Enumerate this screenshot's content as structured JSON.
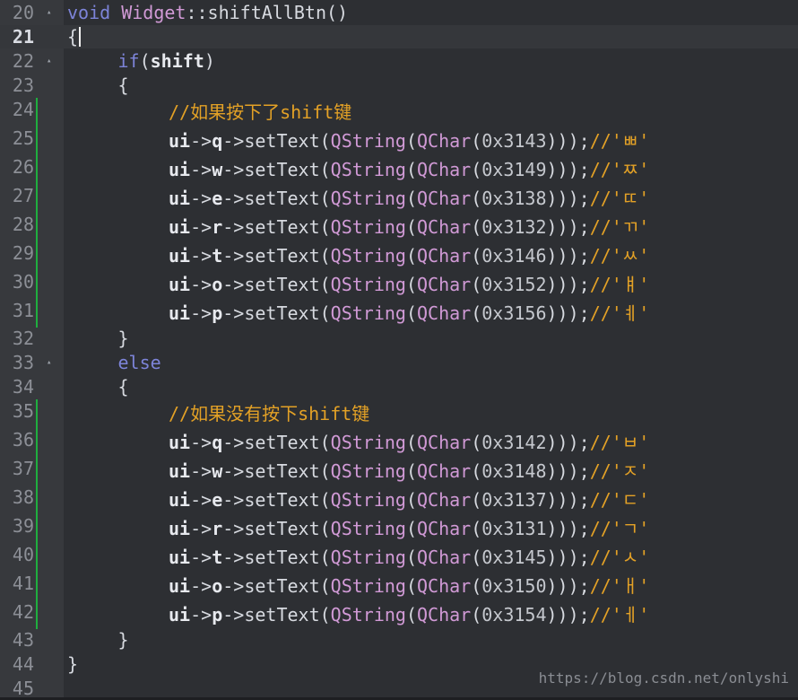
{
  "colors": {
    "background": "#2d2f33",
    "gutter": "#37393d",
    "keyword": "#7d84d9",
    "class": "#d19ad6",
    "identifier": "#e7e9ee",
    "comment": "#e3a126",
    "change_marker": "#1fae3f"
  },
  "watermark": "https://blog.csdn.net/onlyshi",
  "lines": [
    {
      "n": "20",
      "fold": true,
      "indent": 0,
      "tokens": [
        {
          "t": "kw",
          "v": "void"
        },
        {
          "t": "p",
          "v": " "
        },
        {
          "t": "cls",
          "v": "Widget"
        },
        {
          "t": "p",
          "v": "::shiftAllBtn()"
        }
      ]
    },
    {
      "n": "21",
      "current": true,
      "indent": 0,
      "cursor": true,
      "tokens": [
        {
          "t": "p",
          "v": "{"
        }
      ]
    },
    {
      "n": "22",
      "fold": true,
      "indent": 1,
      "tokens": [
        {
          "t": "kw",
          "v": "if"
        },
        {
          "t": "p",
          "v": "("
        },
        {
          "t": "id",
          "v": "shift"
        },
        {
          "t": "p",
          "v": ")"
        }
      ]
    },
    {
      "n": "23",
      "indent": 1,
      "tokens": [
        {
          "t": "p",
          "v": "{"
        }
      ]
    },
    {
      "n": "24",
      "mark": true,
      "indent": 2,
      "tokens": [
        {
          "t": "com",
          "v": "//如果按下了shift键"
        }
      ]
    },
    {
      "n": "25",
      "mark": true,
      "indent": 2,
      "tokens": [
        {
          "t": "id",
          "v": "ui"
        },
        {
          "t": "p",
          "v": "->"
        },
        {
          "t": "id",
          "v": "q"
        },
        {
          "t": "p",
          "v": "->setText("
        },
        {
          "t": "cls",
          "v": "QString"
        },
        {
          "t": "p",
          "v": "("
        },
        {
          "t": "cls",
          "v": "QChar"
        },
        {
          "t": "p",
          "v": "("
        },
        {
          "t": "num",
          "v": "0x3143"
        },
        {
          "t": "p",
          "v": ")));"
        },
        {
          "t": "com",
          "v": "//'ㅃ'"
        }
      ]
    },
    {
      "n": "26",
      "mark": true,
      "indent": 2,
      "tokens": [
        {
          "t": "id",
          "v": "ui"
        },
        {
          "t": "p",
          "v": "->"
        },
        {
          "t": "id",
          "v": "w"
        },
        {
          "t": "p",
          "v": "->setText("
        },
        {
          "t": "cls",
          "v": "QString"
        },
        {
          "t": "p",
          "v": "("
        },
        {
          "t": "cls",
          "v": "QChar"
        },
        {
          "t": "p",
          "v": "("
        },
        {
          "t": "num",
          "v": "0x3149"
        },
        {
          "t": "p",
          "v": ")));"
        },
        {
          "t": "com",
          "v": "//'ㅉ'"
        }
      ]
    },
    {
      "n": "27",
      "mark": true,
      "indent": 2,
      "tokens": [
        {
          "t": "id",
          "v": "ui"
        },
        {
          "t": "p",
          "v": "->"
        },
        {
          "t": "id",
          "v": "e"
        },
        {
          "t": "p",
          "v": "->setText("
        },
        {
          "t": "cls",
          "v": "QString"
        },
        {
          "t": "p",
          "v": "("
        },
        {
          "t": "cls",
          "v": "QChar"
        },
        {
          "t": "p",
          "v": "("
        },
        {
          "t": "num",
          "v": "0x3138"
        },
        {
          "t": "p",
          "v": ")));"
        },
        {
          "t": "com",
          "v": "//'ㄸ'"
        }
      ]
    },
    {
      "n": "28",
      "mark": true,
      "indent": 2,
      "tokens": [
        {
          "t": "id",
          "v": "ui"
        },
        {
          "t": "p",
          "v": "->"
        },
        {
          "t": "id",
          "v": "r"
        },
        {
          "t": "p",
          "v": "->setText("
        },
        {
          "t": "cls",
          "v": "QString"
        },
        {
          "t": "p",
          "v": "("
        },
        {
          "t": "cls",
          "v": "QChar"
        },
        {
          "t": "p",
          "v": "("
        },
        {
          "t": "num",
          "v": "0x3132"
        },
        {
          "t": "p",
          "v": ")));"
        },
        {
          "t": "com",
          "v": "//'ㄲ'"
        }
      ]
    },
    {
      "n": "29",
      "mark": true,
      "indent": 2,
      "tokens": [
        {
          "t": "id",
          "v": "ui"
        },
        {
          "t": "p",
          "v": "->"
        },
        {
          "t": "id",
          "v": "t"
        },
        {
          "t": "p",
          "v": "->setText("
        },
        {
          "t": "cls",
          "v": "QString"
        },
        {
          "t": "p",
          "v": "("
        },
        {
          "t": "cls",
          "v": "QChar"
        },
        {
          "t": "p",
          "v": "("
        },
        {
          "t": "num",
          "v": "0x3146"
        },
        {
          "t": "p",
          "v": ")));"
        },
        {
          "t": "com",
          "v": "//'ㅆ'"
        }
      ]
    },
    {
      "n": "30",
      "mark": true,
      "indent": 2,
      "tokens": [
        {
          "t": "id",
          "v": "ui"
        },
        {
          "t": "p",
          "v": "->"
        },
        {
          "t": "id",
          "v": "o"
        },
        {
          "t": "p",
          "v": "->setText("
        },
        {
          "t": "cls",
          "v": "QString"
        },
        {
          "t": "p",
          "v": "("
        },
        {
          "t": "cls",
          "v": "QChar"
        },
        {
          "t": "p",
          "v": "("
        },
        {
          "t": "num",
          "v": "0x3152"
        },
        {
          "t": "p",
          "v": ")));"
        },
        {
          "t": "com",
          "v": "//'ㅒ'"
        }
      ]
    },
    {
      "n": "31",
      "mark": true,
      "indent": 2,
      "tokens": [
        {
          "t": "id",
          "v": "ui"
        },
        {
          "t": "p",
          "v": "->"
        },
        {
          "t": "id",
          "v": "p"
        },
        {
          "t": "p",
          "v": "->setText("
        },
        {
          "t": "cls",
          "v": "QString"
        },
        {
          "t": "p",
          "v": "("
        },
        {
          "t": "cls",
          "v": "QChar"
        },
        {
          "t": "p",
          "v": "("
        },
        {
          "t": "num",
          "v": "0x3156"
        },
        {
          "t": "p",
          "v": ")));"
        },
        {
          "t": "com",
          "v": "//'ㅖ'"
        }
      ]
    },
    {
      "n": "32",
      "indent": 1,
      "tokens": [
        {
          "t": "p",
          "v": "}"
        }
      ]
    },
    {
      "n": "33",
      "fold": true,
      "indent": 1,
      "tokens": [
        {
          "t": "kw",
          "v": "else"
        }
      ]
    },
    {
      "n": "34",
      "indent": 1,
      "tokens": [
        {
          "t": "p",
          "v": "{"
        }
      ]
    },
    {
      "n": "35",
      "mark": true,
      "indent": 2,
      "tokens": [
        {
          "t": "com",
          "v": "//如果没有按下shift键"
        }
      ]
    },
    {
      "n": "36",
      "mark": true,
      "indent": 2,
      "tokens": [
        {
          "t": "id",
          "v": "ui"
        },
        {
          "t": "p",
          "v": "->"
        },
        {
          "t": "id",
          "v": "q"
        },
        {
          "t": "p",
          "v": "->setText("
        },
        {
          "t": "cls",
          "v": "QString"
        },
        {
          "t": "p",
          "v": "("
        },
        {
          "t": "cls",
          "v": "QChar"
        },
        {
          "t": "p",
          "v": "("
        },
        {
          "t": "num",
          "v": "0x3142"
        },
        {
          "t": "p",
          "v": ")));"
        },
        {
          "t": "com",
          "v": "//'ㅂ'"
        }
      ]
    },
    {
      "n": "37",
      "mark": true,
      "indent": 2,
      "tokens": [
        {
          "t": "id",
          "v": "ui"
        },
        {
          "t": "p",
          "v": "->"
        },
        {
          "t": "id",
          "v": "w"
        },
        {
          "t": "p",
          "v": "->setText("
        },
        {
          "t": "cls",
          "v": "QString"
        },
        {
          "t": "p",
          "v": "("
        },
        {
          "t": "cls",
          "v": "QChar"
        },
        {
          "t": "p",
          "v": "("
        },
        {
          "t": "num",
          "v": "0x3148"
        },
        {
          "t": "p",
          "v": ")));"
        },
        {
          "t": "com",
          "v": "//'ㅈ'"
        }
      ]
    },
    {
      "n": "38",
      "mark": true,
      "indent": 2,
      "tokens": [
        {
          "t": "id",
          "v": "ui"
        },
        {
          "t": "p",
          "v": "->"
        },
        {
          "t": "id",
          "v": "e"
        },
        {
          "t": "p",
          "v": "->setText("
        },
        {
          "t": "cls",
          "v": "QString"
        },
        {
          "t": "p",
          "v": "("
        },
        {
          "t": "cls",
          "v": "QChar"
        },
        {
          "t": "p",
          "v": "("
        },
        {
          "t": "num",
          "v": "0x3137"
        },
        {
          "t": "p",
          "v": ")));"
        },
        {
          "t": "com",
          "v": "//'ㄷ'"
        }
      ]
    },
    {
      "n": "39",
      "mark": true,
      "indent": 2,
      "tokens": [
        {
          "t": "id",
          "v": "ui"
        },
        {
          "t": "p",
          "v": "->"
        },
        {
          "t": "id",
          "v": "r"
        },
        {
          "t": "p",
          "v": "->setText("
        },
        {
          "t": "cls",
          "v": "QString"
        },
        {
          "t": "p",
          "v": "("
        },
        {
          "t": "cls",
          "v": "QChar"
        },
        {
          "t": "p",
          "v": "("
        },
        {
          "t": "num",
          "v": "0x3131"
        },
        {
          "t": "p",
          "v": ")));"
        },
        {
          "t": "com",
          "v": "//'ㄱ'"
        }
      ]
    },
    {
      "n": "40",
      "mark": true,
      "indent": 2,
      "tokens": [
        {
          "t": "id",
          "v": "ui"
        },
        {
          "t": "p",
          "v": "->"
        },
        {
          "t": "id",
          "v": "t"
        },
        {
          "t": "p",
          "v": "->setText("
        },
        {
          "t": "cls",
          "v": "QString"
        },
        {
          "t": "p",
          "v": "("
        },
        {
          "t": "cls",
          "v": "QChar"
        },
        {
          "t": "p",
          "v": "("
        },
        {
          "t": "num",
          "v": "0x3145"
        },
        {
          "t": "p",
          "v": ")));"
        },
        {
          "t": "com",
          "v": "//'ㅅ'"
        }
      ]
    },
    {
      "n": "41",
      "mark": true,
      "indent": 2,
      "tokens": [
        {
          "t": "id",
          "v": "ui"
        },
        {
          "t": "p",
          "v": "->"
        },
        {
          "t": "id",
          "v": "o"
        },
        {
          "t": "p",
          "v": "->setText("
        },
        {
          "t": "cls",
          "v": "QString"
        },
        {
          "t": "p",
          "v": "("
        },
        {
          "t": "cls",
          "v": "QChar"
        },
        {
          "t": "p",
          "v": "("
        },
        {
          "t": "num",
          "v": "0x3150"
        },
        {
          "t": "p",
          "v": ")));"
        },
        {
          "t": "com",
          "v": "//'ㅐ'"
        }
      ]
    },
    {
      "n": "42",
      "mark": true,
      "indent": 2,
      "tokens": [
        {
          "t": "id",
          "v": "ui"
        },
        {
          "t": "p",
          "v": "->"
        },
        {
          "t": "id",
          "v": "p"
        },
        {
          "t": "p",
          "v": "->setText("
        },
        {
          "t": "cls",
          "v": "QString"
        },
        {
          "t": "p",
          "v": "("
        },
        {
          "t": "cls",
          "v": "QChar"
        },
        {
          "t": "p",
          "v": "("
        },
        {
          "t": "num",
          "v": "0x3154"
        },
        {
          "t": "p",
          "v": ")));"
        },
        {
          "t": "com",
          "v": "//'ㅔ'"
        }
      ]
    },
    {
      "n": "43",
      "indent": 1,
      "tokens": [
        {
          "t": "p",
          "v": "}"
        }
      ]
    },
    {
      "n": "44",
      "indent": 0,
      "tokens": [
        {
          "t": "p",
          "v": "}"
        }
      ]
    },
    {
      "n": "45",
      "indent": 0,
      "tokens": []
    }
  ]
}
